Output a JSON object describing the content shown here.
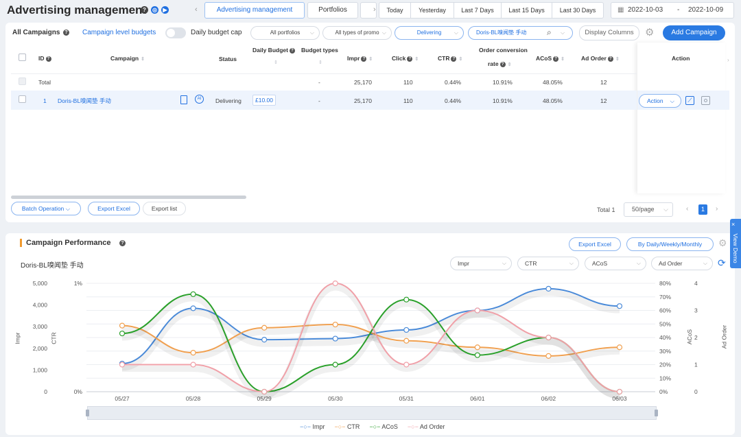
{
  "header": {
    "title": "Advertising management",
    "tabs": [
      "Advertising management",
      "Portfolios"
    ],
    "ranges": [
      "Today",
      "Yesterday",
      "Last 7 Days",
      "Last 15 Days",
      "Last 30 Days"
    ],
    "date_start": "2022-10-03",
    "date_sep": "-",
    "date_end": "2022-10-09"
  },
  "filters": {
    "all_campaigns": "All Campaigns",
    "campaign_budgets": "Campaign level budgets",
    "daily_cap": "Daily budget cap",
    "portfolios": "All portfolios",
    "types": "All types of promo",
    "status": "Delivering",
    "search": "Doris-BL嗅闻垫 手动",
    "display_columns": "Display Columns",
    "add_campaign": "Add Campaign"
  },
  "table": {
    "headers": {
      "id": "ID",
      "campaign": "Campaign",
      "status": "Status",
      "daily_budget": "Daily Budget",
      "budget_types": "Budget types",
      "impr": "Impr",
      "click": "Click",
      "ctr": "CTR",
      "order_conv1": "Order conversion",
      "order_conv2": "rate",
      "acos": "ACoS",
      "ad_order": "Ad Order",
      "action": "Action"
    },
    "total": {
      "label": "Total",
      "budget_types": "-",
      "impr": "25,170",
      "click": "110",
      "ctr": "0.44%",
      "conv": "10.91%",
      "acos": "48.05%",
      "ad_order": "12"
    },
    "row": {
      "id": "1",
      "campaign": "Doris-BL嗅闻垫 手动",
      "status": "Delivering",
      "budget": "£10.00",
      "budget_types": "-",
      "impr": "25,170",
      "click": "110",
      "ctr": "0.44%",
      "conv": "10.91%",
      "acos": "48.05%",
      "ad_order": "12",
      "action": "Action"
    }
  },
  "footer": {
    "batch": "Batch Operation",
    "export_excel": "Export Excel",
    "export_list": "Export list",
    "total": "Total 1",
    "per_page": "50/page",
    "page": "1"
  },
  "performance": {
    "title": "Campaign Performance",
    "export_excel": "Export Excel",
    "by_period": "By Daily/Weekly/Monthly",
    "view_demo": "View Demo",
    "campaign_name": "Doris-BL嗅闻垫 手动",
    "selectors": [
      "Impr",
      "CTR",
      "ACoS",
      "Ad Order"
    ]
  },
  "chart_data": {
    "type": "line",
    "categories": [
      "05/27",
      "05/28",
      "05/29",
      "05/30",
      "05/31",
      "06/01",
      "06/02",
      "06/03"
    ],
    "axes": {
      "impr": {
        "label": "Impr",
        "ticks": [
          "5,000",
          "4,000",
          "3,000",
          "2,000",
          "1,000",
          "0"
        ],
        "ylim": [
          0,
          5000
        ]
      },
      "ctr": {
        "label": "CTR",
        "ticks": [
          "1%",
          "0%"
        ],
        "ylim": [
          0,
          1
        ]
      },
      "acos": {
        "label": "ACoS",
        "ticks": [
          "80%",
          "70%",
          "60%",
          "50%",
          "40%",
          "30%",
          "20%",
          "10%",
          "0%"
        ],
        "ylim": [
          0,
          80
        ]
      },
      "ad_order": {
        "label": "Ad Order",
        "ticks": [
          "4",
          "3",
          "2",
          "1",
          "0"
        ],
        "ylim": [
          0,
          4
        ]
      }
    },
    "series": [
      {
        "name": "Impr",
        "axis": "impr",
        "color": "#4a8ad8",
        "values": [
          1300,
          3850,
          2400,
          2450,
          2850,
          3750,
          4750,
          3950
        ]
      },
      {
        "name": "CTR",
        "axis": "ctr",
        "color": "#f0a050",
        "values": [
          0.61,
          0.36,
          0.59,
          0.62,
          0.47,
          0.41,
          0.33,
          0.41
        ]
      },
      {
        "name": "ACoS",
        "axis": "acos",
        "color": "#2aa02a",
        "values": [
          43,
          72,
          0,
          20,
          68,
          27,
          40,
          0
        ]
      },
      {
        "name": "Ad Order",
        "axis": "ad_order",
        "color": "#f0a0a8",
        "values": [
          1,
          1,
          0,
          4,
          1,
          3,
          2,
          0
        ]
      }
    ],
    "legend": "bottom",
    "grid": true
  },
  "colors": {
    "accent": "#1f6fe0",
    "orange": "#f09a2e"
  }
}
